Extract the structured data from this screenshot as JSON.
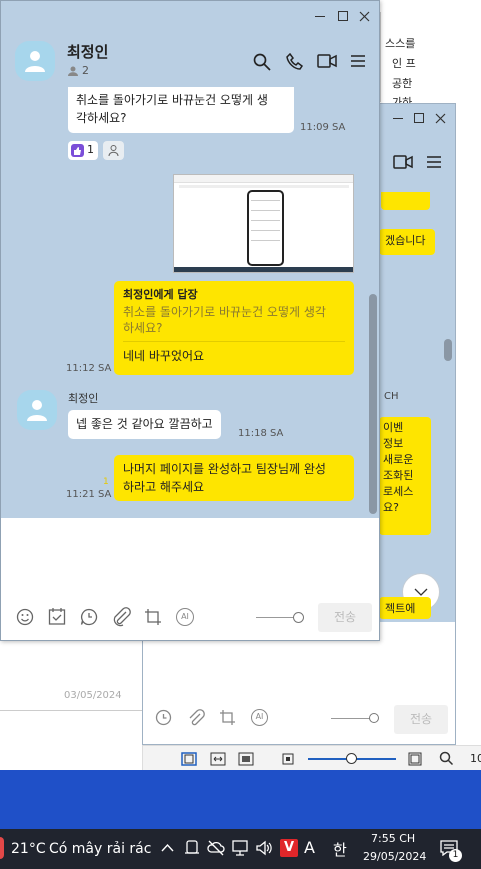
{
  "doc": {
    "lines": [
      "스스를",
      "인 프",
      "공한",
      "가하"
    ],
    "footer_date": "03/05/2024"
  },
  "chat_main": {
    "title": "최정인",
    "member_count": "2",
    "msg1": {
      "text_line1": "취소를 돌아가기로 바뀨눈건 오떻게 생",
      "text_line2": "각하세요?",
      "time": "11:09 SA",
      "reaction_count": "1"
    },
    "reply": {
      "header": "최정인에게 답장",
      "quoted_line1": "취소를 돌아가기로 바뀨눈건 오떻게 생각",
      "quoted_line2": "하세요?",
      "body": "네네 바꾸었어요",
      "time": "11:12 SA"
    },
    "msg3": {
      "sender": "최정인",
      "text": "넵 좋은 것 같아요 깔끔하고",
      "time": "11:18 SA"
    },
    "msg4": {
      "line1": "나머지 페이지를 완성하고 팀장님께 완성",
      "line2": "하라고 해주세요",
      "time": "11:21 SA",
      "read_mark": "1"
    },
    "send_label": "전송"
  },
  "chat_second": {
    "snippet1": "겠습니다",
    "time_frag": "CH",
    "snippet_lines": [
      "이벤",
      "정보",
      "새로운",
      "조화된",
      "로세스",
      "요?"
    ],
    "snippet_bottom": "젝트에",
    "send_label": "전송"
  },
  "taskbar": {
    "temp": "21°C",
    "weather": "Có mây rải rác",
    "ime": "A",
    "lang": "한",
    "time": "7:55 CH",
    "date": "29/05/2024",
    "notif_count": "1"
  },
  "colors": {
    "chat_bg": "#bacfe3",
    "bubble_yellow": "#fee500",
    "taskbar": "#20242e",
    "desktop_blue": "#1f50c8"
  }
}
